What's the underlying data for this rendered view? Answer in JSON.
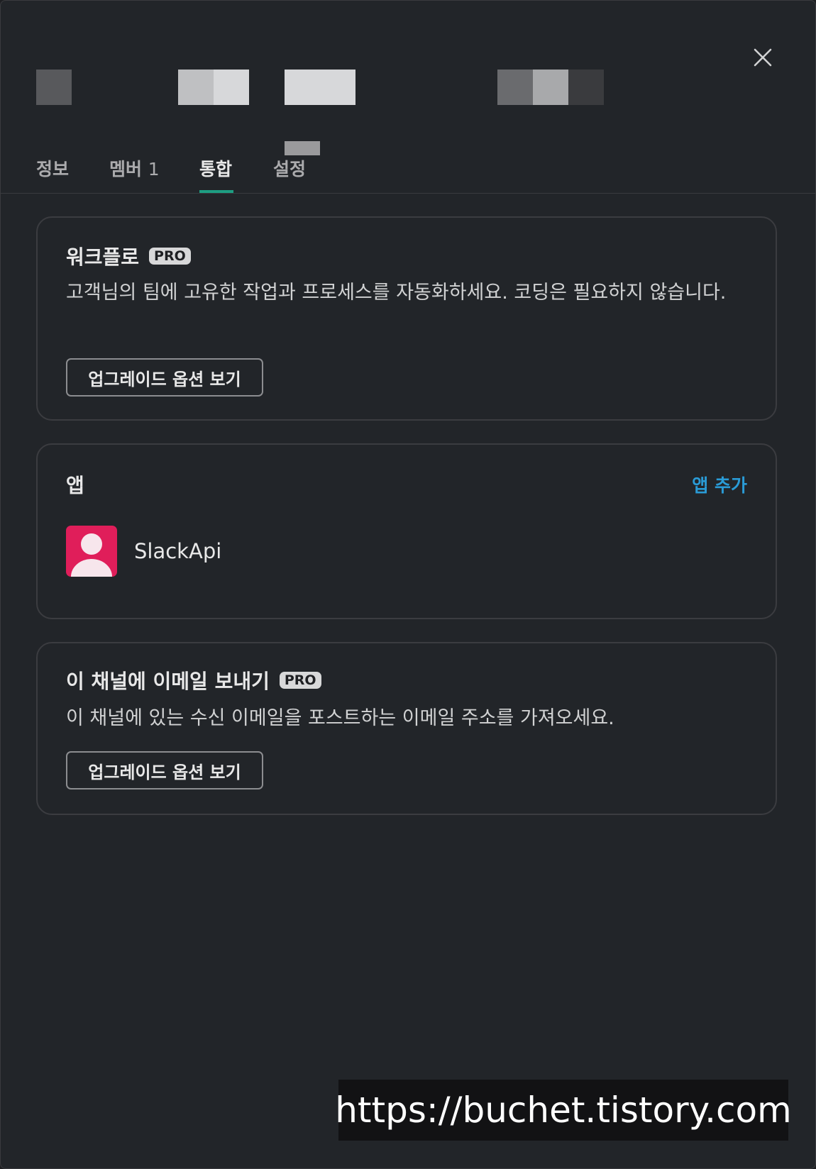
{
  "header": {
    "close_icon": "close-icon",
    "obscured_title_blocks": [
      "#58595c",
      "#bfc0c2",
      "#d7d8da",
      "#d7d8da",
      "#6a6b6e",
      "#a8a9ab",
      "#3a3b3e"
    ]
  },
  "tabs": [
    {
      "label": "정보",
      "active": false
    },
    {
      "label": "멤버",
      "count": "1",
      "active": false
    },
    {
      "label": "통합",
      "active": true
    },
    {
      "label": "설정",
      "active": false
    }
  ],
  "workflow": {
    "title": "워크플로",
    "badge": "PRO",
    "description": "고객님의 팀에 고유한 작업과 프로세스를 자동화하세요. 코딩은 필요하지 않습니다.",
    "button": "업그레이드 옵션 보기"
  },
  "apps": {
    "title": "앱",
    "add_label": "앱 추가",
    "items": [
      {
        "name": "SlackApi",
        "avatar_color": "#e01e5a",
        "icon": "user-avatar-icon"
      }
    ]
  },
  "email": {
    "title": "이 채널에 이메일 보내기",
    "badge": "PRO",
    "description": "이 채널에 있는 수신 이메일을 포스트하는 이메일 주소를 가져오세요.",
    "button": "업그레이드 옵션 보기"
  },
  "watermark": "https://buchet.tistory.com",
  "colors": {
    "background": "#222529",
    "accent_tab": "#1d9e82",
    "link": "#2a9bd6"
  }
}
